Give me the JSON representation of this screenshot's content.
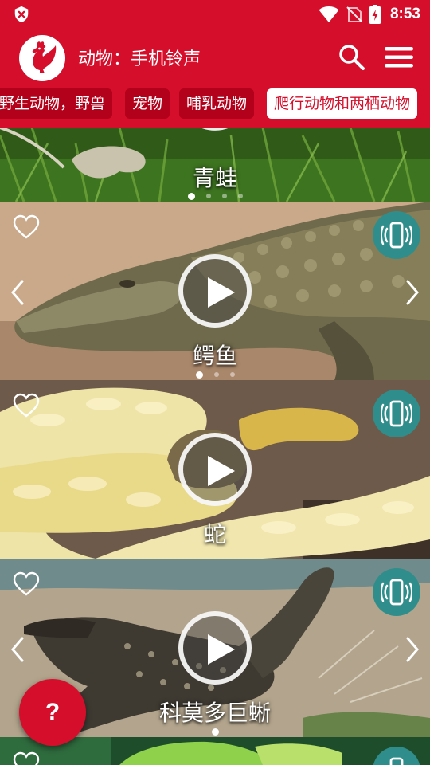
{
  "status_bar": {
    "time": "8:53",
    "icons": [
      "shield-x-icon",
      "wifi-icon",
      "no-sim-icon",
      "battery-charging-icon"
    ]
  },
  "app_bar": {
    "title": "动物：手机铃声",
    "logo": "rooster-logo",
    "search_icon": "search-icon",
    "menu_icon": "hamburger-menu-icon"
  },
  "categories": [
    {
      "label": "野生动物，野兽",
      "active": false
    },
    {
      "label": "宠物",
      "active": false
    },
    {
      "label": "哺乳动物",
      "active": false
    },
    {
      "label": "爬行动物和两栖动物",
      "active": true
    }
  ],
  "cards": [
    {
      "name": "青蛙",
      "photo": "frog-grass",
      "dots": 4,
      "active_dot": 0
    },
    {
      "name": "鳄鱼",
      "photo": "crocodile",
      "dots": 3,
      "active_dot": 0
    },
    {
      "name": "蛇",
      "photo": "yellow-python",
      "dots": 0,
      "active_dot": 0
    },
    {
      "name": "科莫多巨蜥",
      "photo": "monitor-lizard",
      "dots": 1,
      "active_dot": 0
    },
    {
      "name": "",
      "photo": "green-chameleon"
    }
  ],
  "fab": {
    "label": "?"
  },
  "colors": {
    "brand_red": "#d50f2b",
    "chip_dark": "#b3001b",
    "ringtone_teal": "#2f8e8b"
  }
}
